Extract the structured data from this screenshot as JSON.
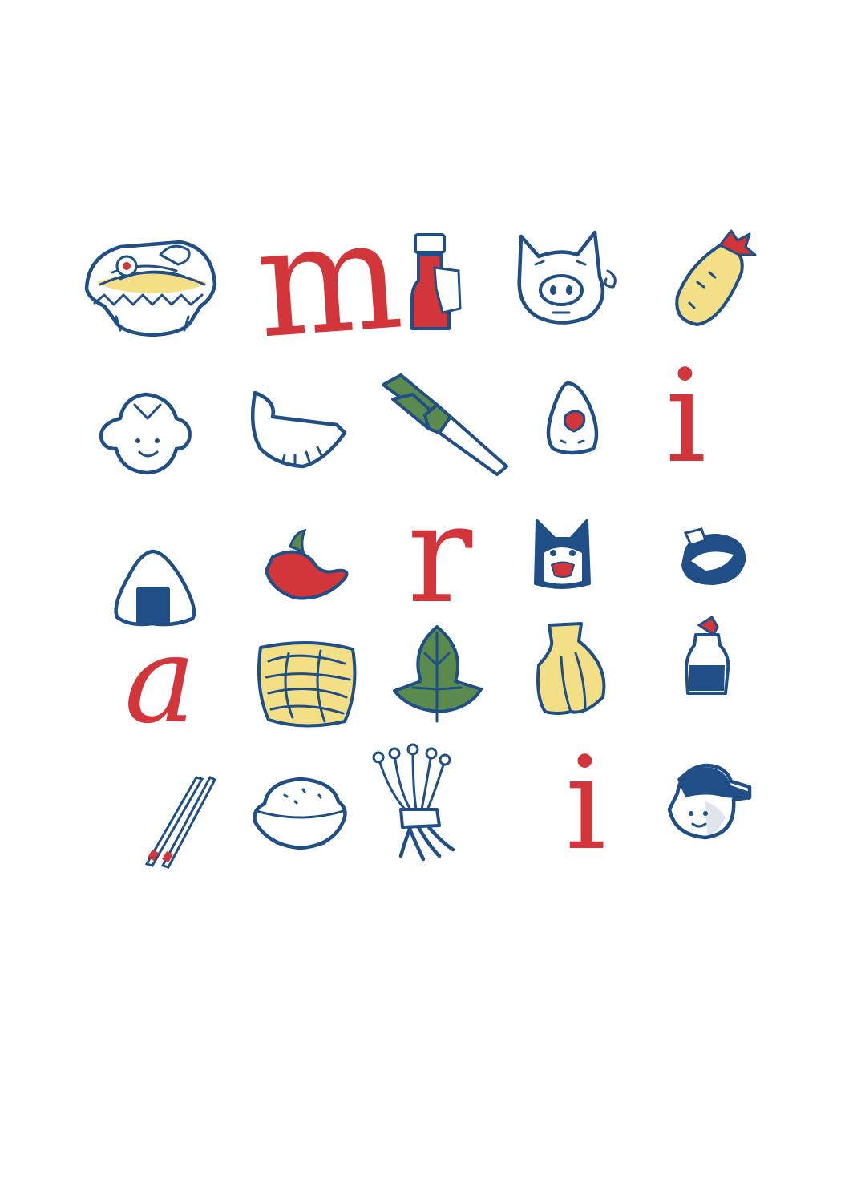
{
  "colors": {
    "background": "#ffffff",
    "ink_blue": "#1f4f86",
    "accent_red": "#d2363a",
    "noodle_yellow": "#f3df86",
    "leaf_green": "#5b8a4e"
  },
  "letters": {
    "m": "m",
    "i_first": "i",
    "r": "r",
    "a": "a",
    "i_second": "i"
  },
  "icons": [
    "ramen-bowl-icon",
    "sauce-bottle-icon",
    "pig-face-icon",
    "shrimp-tempura-icon",
    "child-face-icon",
    "gyoza-icon",
    "leek-icon",
    "onigiri-filled-icon",
    "onigiri-icon",
    "chili-pepper-icon",
    "cat-face-icon",
    "shiitake-icon",
    "noodles-icon",
    "shiso-leaf-icon",
    "xiaolongbao-icon",
    "soy-sauce-icon",
    "chopsticks-icon",
    "rice-bowl-icon",
    "enoki-icon",
    "cap-boy-icon"
  ]
}
